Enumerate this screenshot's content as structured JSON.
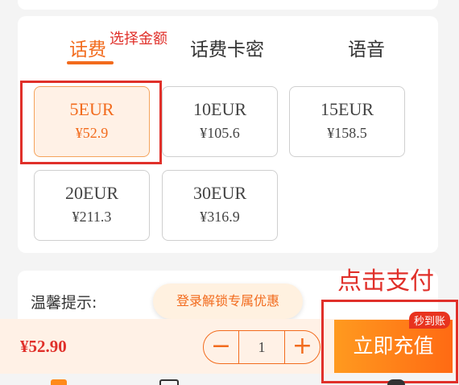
{
  "tabs": [
    {
      "label": "话费",
      "active": true
    },
    {
      "label": "话费卡密",
      "active": false
    },
    {
      "label": "语音",
      "active": false
    }
  ],
  "annotations": {
    "select_amount": "选择金额",
    "click_pay": "点击支付"
  },
  "options": [
    {
      "amount": "5EUR",
      "price": "¥52.9",
      "selected": true
    },
    {
      "amount": "10EUR",
      "price": "¥105.6",
      "selected": false
    },
    {
      "amount": "15EUR",
      "price": "¥158.5",
      "selected": false
    },
    {
      "amount": "20EUR",
      "price": "¥211.3",
      "selected": false
    },
    {
      "amount": "30EUR",
      "price": "¥316.9",
      "selected": false
    }
  ],
  "tips": {
    "label": "温馨提示:"
  },
  "login_promo": "登录解锁专属优惠",
  "footer": {
    "total": "¥52.90",
    "quantity": "1",
    "minus_icon": "minus-icon",
    "plus_icon": "plus-icon",
    "buy_label": "立即充值",
    "badge": "秒到账"
  },
  "colors": {
    "accent": "#f26b1d",
    "annotation": "#e0302a"
  }
}
